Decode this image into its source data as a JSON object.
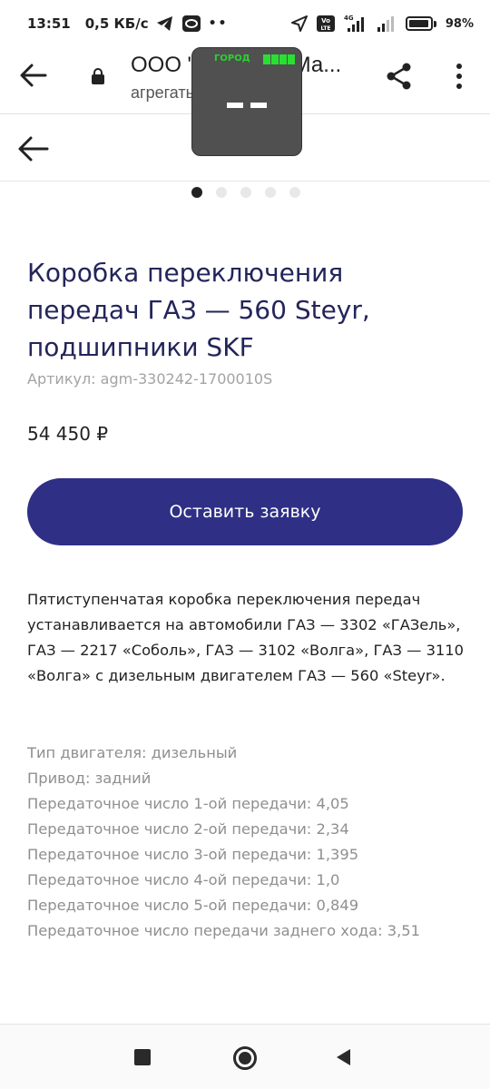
{
  "status": {
    "time": "13:51",
    "speed": "0,5 КБ/с",
    "battery": "98%",
    "battery_level": 0.98,
    "icons": [
      "telegram-icon",
      "vpn-icon",
      "more-dots-icon",
      "location-arrow-icon",
      "volte-icon",
      "signal-4g-icon",
      "signal-icon",
      "battery-icon"
    ],
    "volte": "Vo LTE",
    "net": "4G"
  },
  "browser": {
    "title": "ООО \"Агрегаты Ма...",
    "url": "агрегатымашин.рф"
  },
  "overlay": {
    "label": "ГОРОД"
  },
  "carousel": {
    "dots": [
      true,
      false,
      false,
      false,
      false
    ]
  },
  "product": {
    "title": "Коробка переключения передач ГАЗ — 560 Steyr, подшипники SKF",
    "sku": "Артикул: agm-330242-1700010S",
    "price": "54 450 ₽",
    "cta_label": "Оставить заявку",
    "description": "Пятиступенчатая коробка переключения передач устанавливается на автомобили ГАЗ — 3302 «ГАЗель», ГАЗ — 2217 «Соболь», ГАЗ — 3102 «Волга», ГАЗ — 3110 «Волга» с дизельным двигателем ГАЗ — 560 «Steyr».",
    "specs": [
      "Тип двигателя: дизельный",
      "Привод: задний",
      "Передаточное число 1-ой передачи: 4,05",
      "Передаточное число 2-ой передачи: 2,34",
      "Передаточное число 3-ой передачи: 1,395",
      "Передаточное число 4-ой передачи: 1,0",
      "Передаточное число 5-ой передачи: 0,849",
      "Передаточное число передачи заднего хода: 3,51"
    ]
  },
  "colors": {
    "accent": "#2e2f85",
    "title": "#23255a",
    "muted": "#8f8f8f",
    "overlay_green": "#29e032"
  }
}
